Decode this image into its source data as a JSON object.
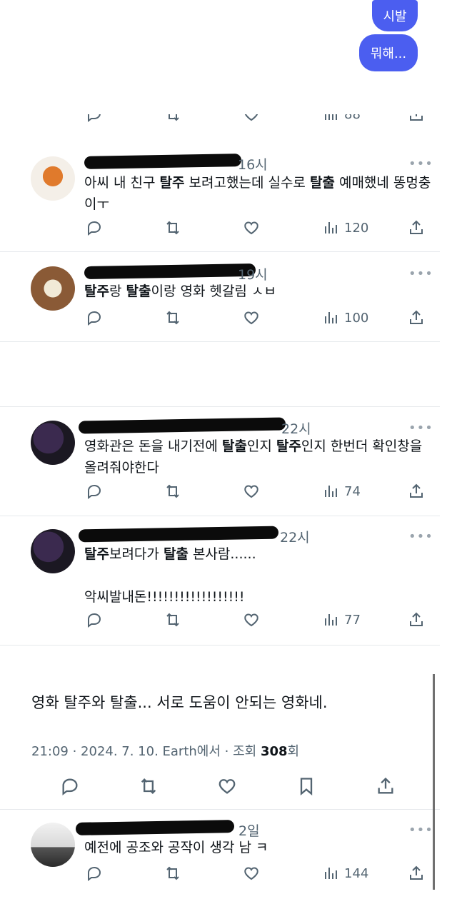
{
  "messages": {
    "bubble1": "시발",
    "bubble2": "뭐해..."
  },
  "partial_row": {
    "views": "88"
  },
  "replies": [
    {
      "time": "16시",
      "text_html": "아씨 내 친구 <b>탈주</b> 보려고했는데 실수로 <b>탈출</b> 예매했네 똥멍충이ㅜ",
      "views": "120"
    },
    {
      "time": "19시",
      "text_html": "<b>탈주</b>랑 <b>탈출</b>이랑 영화 헷갈림 ㅅㅂ",
      "views": "100"
    },
    {
      "time": "22시",
      "text_html": "영화관은 돈을 내기전에 <b>탈출</b>인지 <b>탈주</b>인지 한번더 확인창을 올려줘야한다",
      "views": "74"
    },
    {
      "time": "22시",
      "text_html": "<b>탈주</b>보려다가 <b>탈출</b> 본사람......<br><br>악씨발내돈!!!!!!!!!!!!!!!!!!",
      "views": "77"
    }
  ],
  "main_post": {
    "text": "영화 탈주와 탈출... 서로 도움이 안되는 영화네.",
    "meta_prefix": "21:09 · 2024. 7. 10. Earth에서 · 조회 ",
    "views": "308",
    "meta_suffix": "회"
  },
  "last_reply": {
    "time": "2일",
    "text": "예전에 공조와 공작이 생각 남 ㅋ",
    "views": "144"
  },
  "icons": [
    "reply-icon",
    "retweet-icon",
    "like-icon",
    "views-icon",
    "share-icon",
    "bookmark-icon",
    "more-icon"
  ],
  "colors": {
    "accent": "#4b5ef0",
    "muted": "#536471",
    "divider": "#e6e9ec"
  }
}
